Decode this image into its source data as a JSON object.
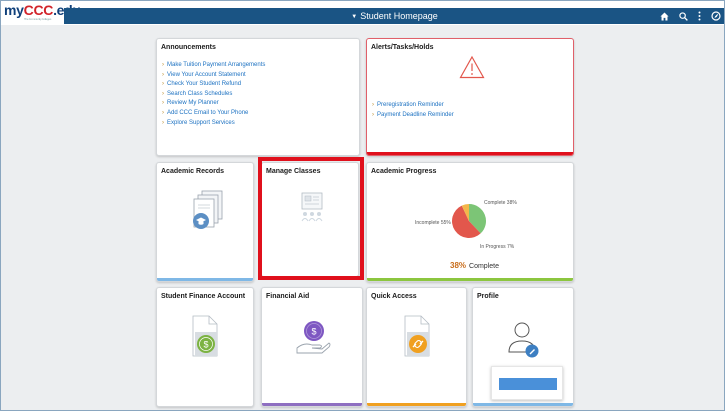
{
  "header": {
    "logo": {
      "part1": "my",
      "part2": "CCC",
      "part3": ".edu",
      "tagline": "The Community Colleges"
    },
    "nav_title": "Student Homepage",
    "nav_icons": [
      "home-icon",
      "search-icon",
      "actions-menu-icon",
      "navbar-icon"
    ]
  },
  "announcements": {
    "title": "Announcements",
    "links": [
      "Make Tuition Payment Arrangements",
      "View Your Account Statement",
      "Check Your Student Refund",
      "Search Class Schedules",
      "Review My Planner",
      "Add CCC Email to Your Phone",
      "Explore Support Services"
    ]
  },
  "alerts": {
    "title": "Alerts/Tasks/Holds",
    "icon": "warning-triangle-icon",
    "links": [
      "Preregistration Reminder",
      "Payment Deadline Reminder"
    ]
  },
  "tiles": {
    "academic_records": {
      "title": "Academic Records",
      "icon": "records-icon"
    },
    "manage_classes": {
      "title": "Manage Classes",
      "icon": "classes-icon"
    },
    "student_finance": {
      "title": "Student Finance Account",
      "icon": "finance-folder-icon"
    },
    "financial_aid": {
      "title": "Financial Aid",
      "icon": "financial-aid-icon"
    },
    "quick_access": {
      "title": "Quick Access",
      "icon": "quick-access-icon"
    },
    "profile": {
      "title": "Profile",
      "icon": "profile-icon"
    }
  },
  "academic_progress": {
    "title": "Academic Progress",
    "labels": {
      "complete": "Complete 38%",
      "incomplete": "Incomplete 55%",
      "in_progress": "In Progress 7%"
    },
    "summary_value": "38%",
    "summary_label": "Complete"
  },
  "chart_data": {
    "type": "pie",
    "categories": [
      "Complete",
      "Incomplete",
      "In Progress"
    ],
    "values": [
      38,
      55,
      7
    ],
    "colors": [
      "#7cc576",
      "#e2574c",
      "#f3b64a"
    ]
  },
  "colors": {
    "nav": "#1a5484",
    "highlight": "#e0101c",
    "link": "#1d72c2",
    "stripe_blue": "#7fb8e6",
    "stripe_green": "#8cc63f",
    "stripe_purple": "#8e6fc1",
    "stripe_orange": "#f0a020"
  }
}
